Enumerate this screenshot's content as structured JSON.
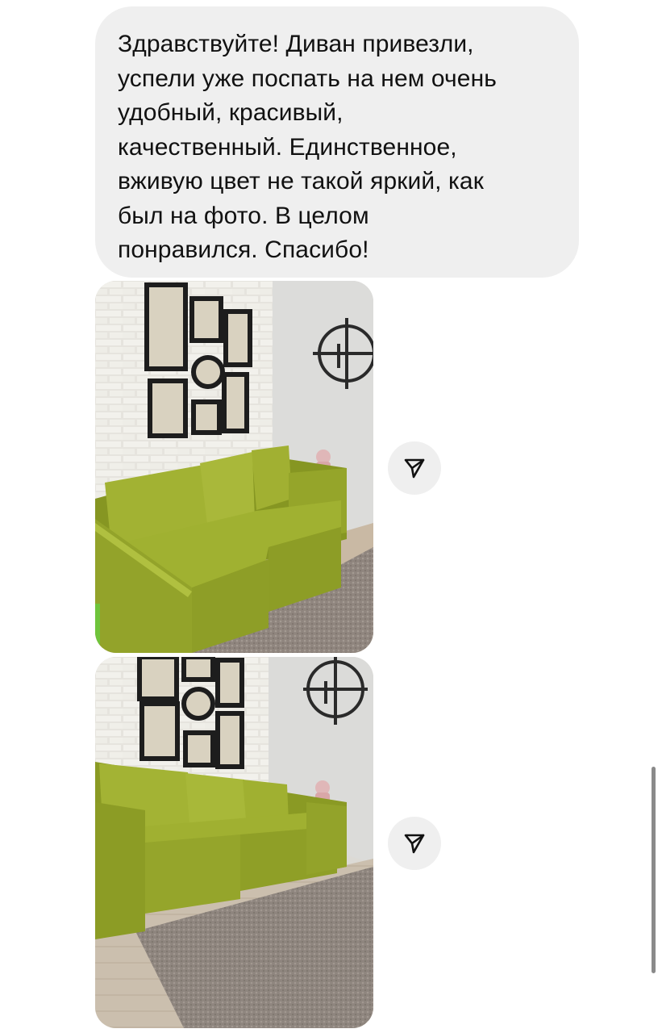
{
  "message": {
    "text": "Здравствуйте!  Диван привезли,\nуспели уже поспать на нем очень\nудобный, красивый,\nкачественный. Единственное,\nвживую цвет не такой яркий, как\nбыл на фото. В целом\nпонравился. Спасибо!"
  },
  "attachments": [
    {
      "kind": "photo",
      "subject": "green-sofa-photo",
      "share_icon": "paper-plane-icon"
    },
    {
      "kind": "photo",
      "subject": "green-sofa-photo",
      "share_icon": "paper-plane-icon"
    }
  ],
  "colors": {
    "bubble_bg": "#efefef",
    "text": "#111111",
    "sofa_green": "#9aab2c",
    "share_button_bg": "#efefef",
    "scrollbar": "#8a8a8a"
  }
}
